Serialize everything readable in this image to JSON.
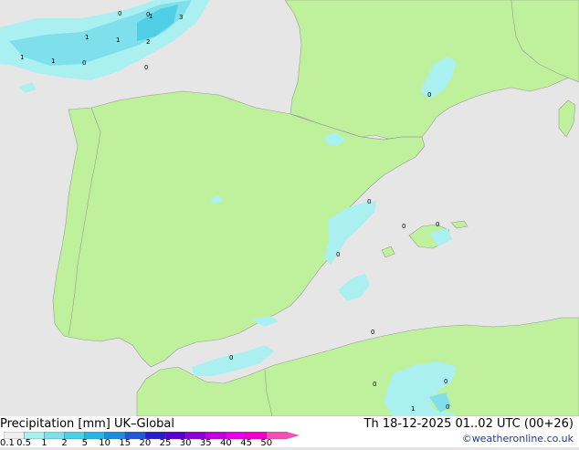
{
  "title": "Precipitation [mm]  UK–Global",
  "valid_time": "Th 18-12-2025 01..02 UTC (00+26)",
  "credit": "©weatheronline.co.uk",
  "legend": {
    "values": [
      "0.1",
      "0.5",
      "1",
      "2",
      "5",
      "10",
      "15",
      "20",
      "25",
      "30",
      "35",
      "40",
      "45",
      "50"
    ],
    "colors": [
      "#f0f0f0",
      "#aaf0f0",
      "#7fe0eb",
      "#4fcfe6",
      "#28b4e6",
      "#1e8cdc",
      "#1e5ad2",
      "#281ec8",
      "#5a00c8",
      "#8c00d2",
      "#be00dc",
      "#e600e6",
      "#f000c8",
      "#f050b4"
    ]
  },
  "precip_labels": [
    "0",
    "1",
    "3",
    "1",
    "1",
    "2",
    "1",
    "1",
    "0",
    "0",
    "0",
    "0",
    "0",
    "0",
    "0",
    "0",
    "0",
    "0",
    "0",
    "0",
    "1",
    "0"
  ],
  "colors": {
    "sea": "#e6e6e6",
    "land": "#bff09b",
    "border": "#999999"
  }
}
